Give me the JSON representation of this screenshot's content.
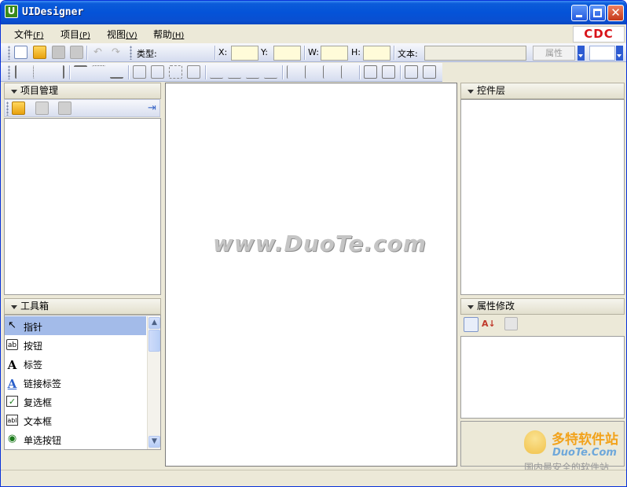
{
  "window": {
    "title": "UIDesigner",
    "app_icon_letter": "U",
    "close_glyph": "✕"
  },
  "menu": {
    "items": [
      {
        "label": "文件",
        "accel": "(F)"
      },
      {
        "label": "项目",
        "accel": "(P)"
      },
      {
        "label": "视图",
        "accel": "(V)"
      },
      {
        "label": "帮助",
        "accel": "(H)"
      }
    ],
    "logo_text": "CDC"
  },
  "toolbar": {
    "type_label": "类型:",
    "x_label": "X:",
    "y_label": "Y:",
    "w_label": "W:",
    "h_label": "H:",
    "text_label": "文本:",
    "properties_button": "属性"
  },
  "project_panel": {
    "title": "项目管理"
  },
  "toolbox": {
    "title": "工具箱",
    "items": [
      {
        "icon": "↖",
        "label": "指针"
      },
      {
        "icon": "ab",
        "label": "按钮"
      },
      {
        "icon": "A",
        "label": "标签"
      },
      {
        "icon": "A",
        "label": "链接标签"
      },
      {
        "icon": "✓",
        "label": "复选框"
      },
      {
        "icon": "abl",
        "label": "文本框"
      },
      {
        "icon": "◉",
        "label": "单选按钮"
      }
    ]
  },
  "controls_panel": {
    "title": "控件层"
  },
  "properties_panel": {
    "title": "属性修改"
  },
  "watermark": "www.DuoTe.com",
  "brand": {
    "name": "多特软件站",
    "domain": "DuoTe.Com",
    "slogan": "国内最安全的软件站"
  }
}
